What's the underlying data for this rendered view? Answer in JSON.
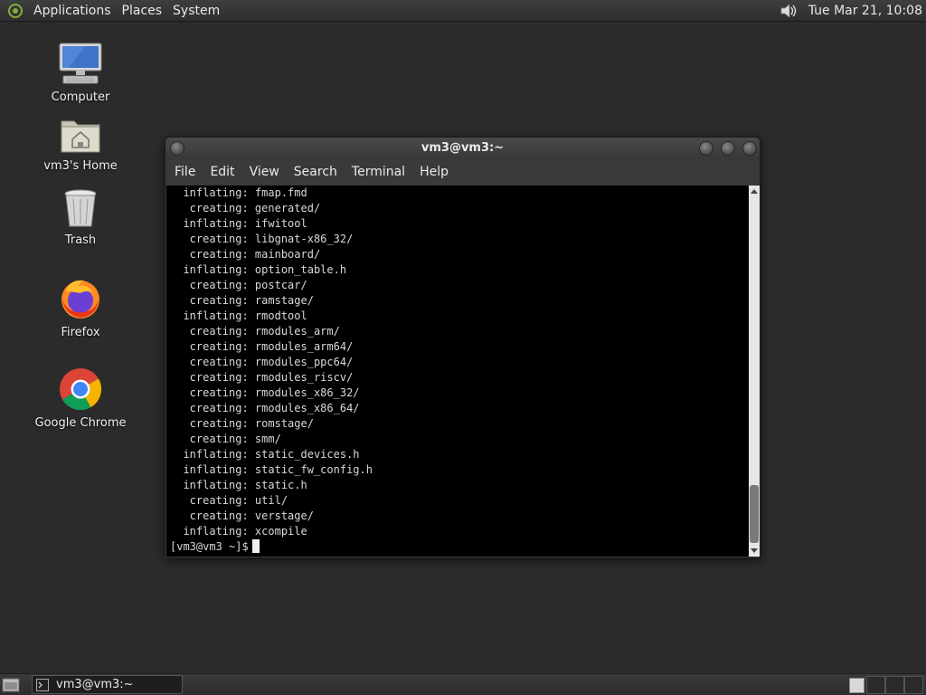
{
  "top_panel": {
    "menus": [
      "Applications",
      "Places",
      "System"
    ],
    "clock": "Tue Mar 21, 10:08"
  },
  "desktop": {
    "icons": [
      {
        "label": "Computer",
        "icon": "computer-icon"
      },
      {
        "label": "vm3's Home",
        "icon": "home-folder-icon"
      },
      {
        "label": "Trash",
        "icon": "trash-icon"
      },
      {
        "label": "Firefox",
        "icon": "firefox-icon"
      },
      {
        "label": "Google Chrome",
        "icon": "chrome-icon"
      }
    ]
  },
  "window": {
    "title": "vm3@vm3:~",
    "menu": [
      "File",
      "Edit",
      "View",
      "Search",
      "Terminal",
      "Help"
    ],
    "lines": [
      "  inflating: fmap.fmd",
      "   creating: generated/",
      "  inflating: ifwitool",
      "   creating: libgnat-x86_32/",
      "   creating: mainboard/",
      "  inflating: option_table.h",
      "   creating: postcar/",
      "   creating: ramstage/",
      "  inflating: rmodtool",
      "   creating: rmodules_arm/",
      "   creating: rmodules_arm64/",
      "   creating: rmodules_ppc64/",
      "   creating: rmodules_riscv/",
      "   creating: rmodules_x86_32/",
      "   creating: rmodules_x86_64/",
      "   creating: romstage/",
      "   creating: smm/",
      "  inflating: static_devices.h",
      "  inflating: static_fw_config.h",
      "  inflating: static.h",
      "   creating: util/",
      "   creating: verstage/",
      "  inflating: xcompile"
    ],
    "prompt": "[vm3@vm3 ~]$"
  },
  "taskbar": {
    "task_label": "vm3@vm3:~"
  },
  "colors": {
    "desktop_bg": "#2b2b2b",
    "terminal_bg": "#000000",
    "terminal_fg": "#d8d8d8"
  }
}
